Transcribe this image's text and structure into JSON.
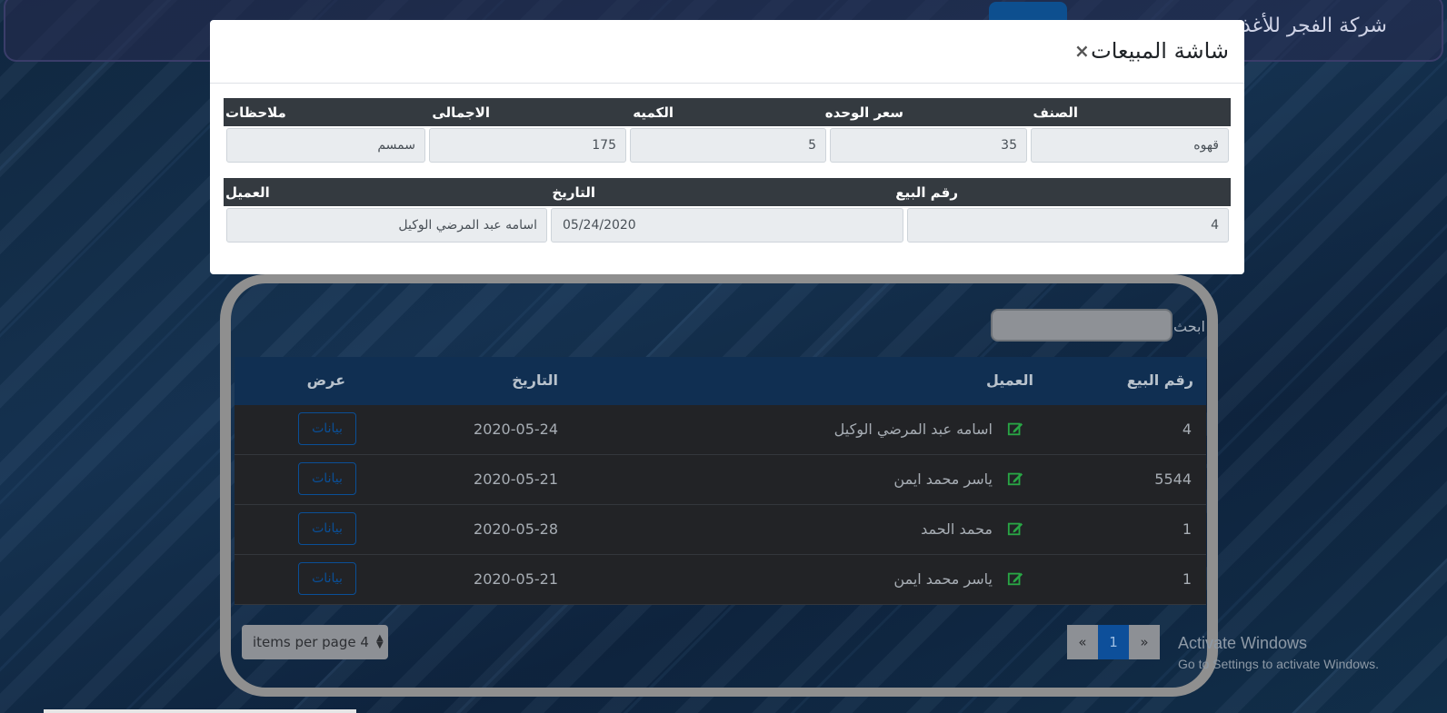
{
  "navbar": {
    "company_name": "شركة الفجر للأغذية"
  },
  "modal": {
    "title": "شاشة المبيعات",
    "close_symbol": "×",
    "items_table": {
      "headers": {
        "item": "الصنف",
        "unit_price": "سعر الوحده",
        "quantity": "الكميه",
        "total": "الاجمالى",
        "notes": "ملاحظات"
      },
      "values": {
        "item": "قهوه",
        "unit_price": "35",
        "quantity": "5",
        "total": "175",
        "notes": "سمسم"
      }
    },
    "sale_table": {
      "headers": {
        "sale_no": "رقم البيع",
        "date": "التاريخ",
        "customer": "العميل"
      },
      "values": {
        "sale_no": "4",
        "date": "05/24/2020",
        "customer": "اسامه عبد المرضي الوكيل"
      }
    }
  },
  "search": {
    "label": "ابحث",
    "value": ""
  },
  "sales_list": {
    "headers": {
      "sale_no": "رقم البيع",
      "customer": "العميل",
      "date": "التاريخ",
      "view": "عرض"
    },
    "rows": [
      {
        "sale_no": "4",
        "customer": "اسامه عبد المرضي الوكيل",
        "date": "2020-05-24",
        "view_label": "بيانات"
      },
      {
        "sale_no": "5544",
        "customer": "ياسر محمد ايمن",
        "date": "2020-05-21",
        "view_label": "بيانات"
      },
      {
        "sale_no": "1",
        "customer": "محمد الحمد",
        "date": "2020-05-28",
        "view_label": "بيانات"
      },
      {
        "sale_no": "1",
        "customer": "ياسر محمد ايمن",
        "date": "2020-05-21",
        "view_label": "بيانات"
      }
    ],
    "row_icon": "edit-icon"
  },
  "pagination": {
    "prev": "«",
    "current": "1",
    "next": "»",
    "per_page_label": "items per page 4"
  },
  "windows_watermark": {
    "title": "Activate Windows",
    "subtitle": "Go to Settings to activate Windows."
  },
  "colors": {
    "accent": "#0a4f97",
    "edit_icon": "#28a745",
    "modal_header_bar": "#343a40"
  }
}
